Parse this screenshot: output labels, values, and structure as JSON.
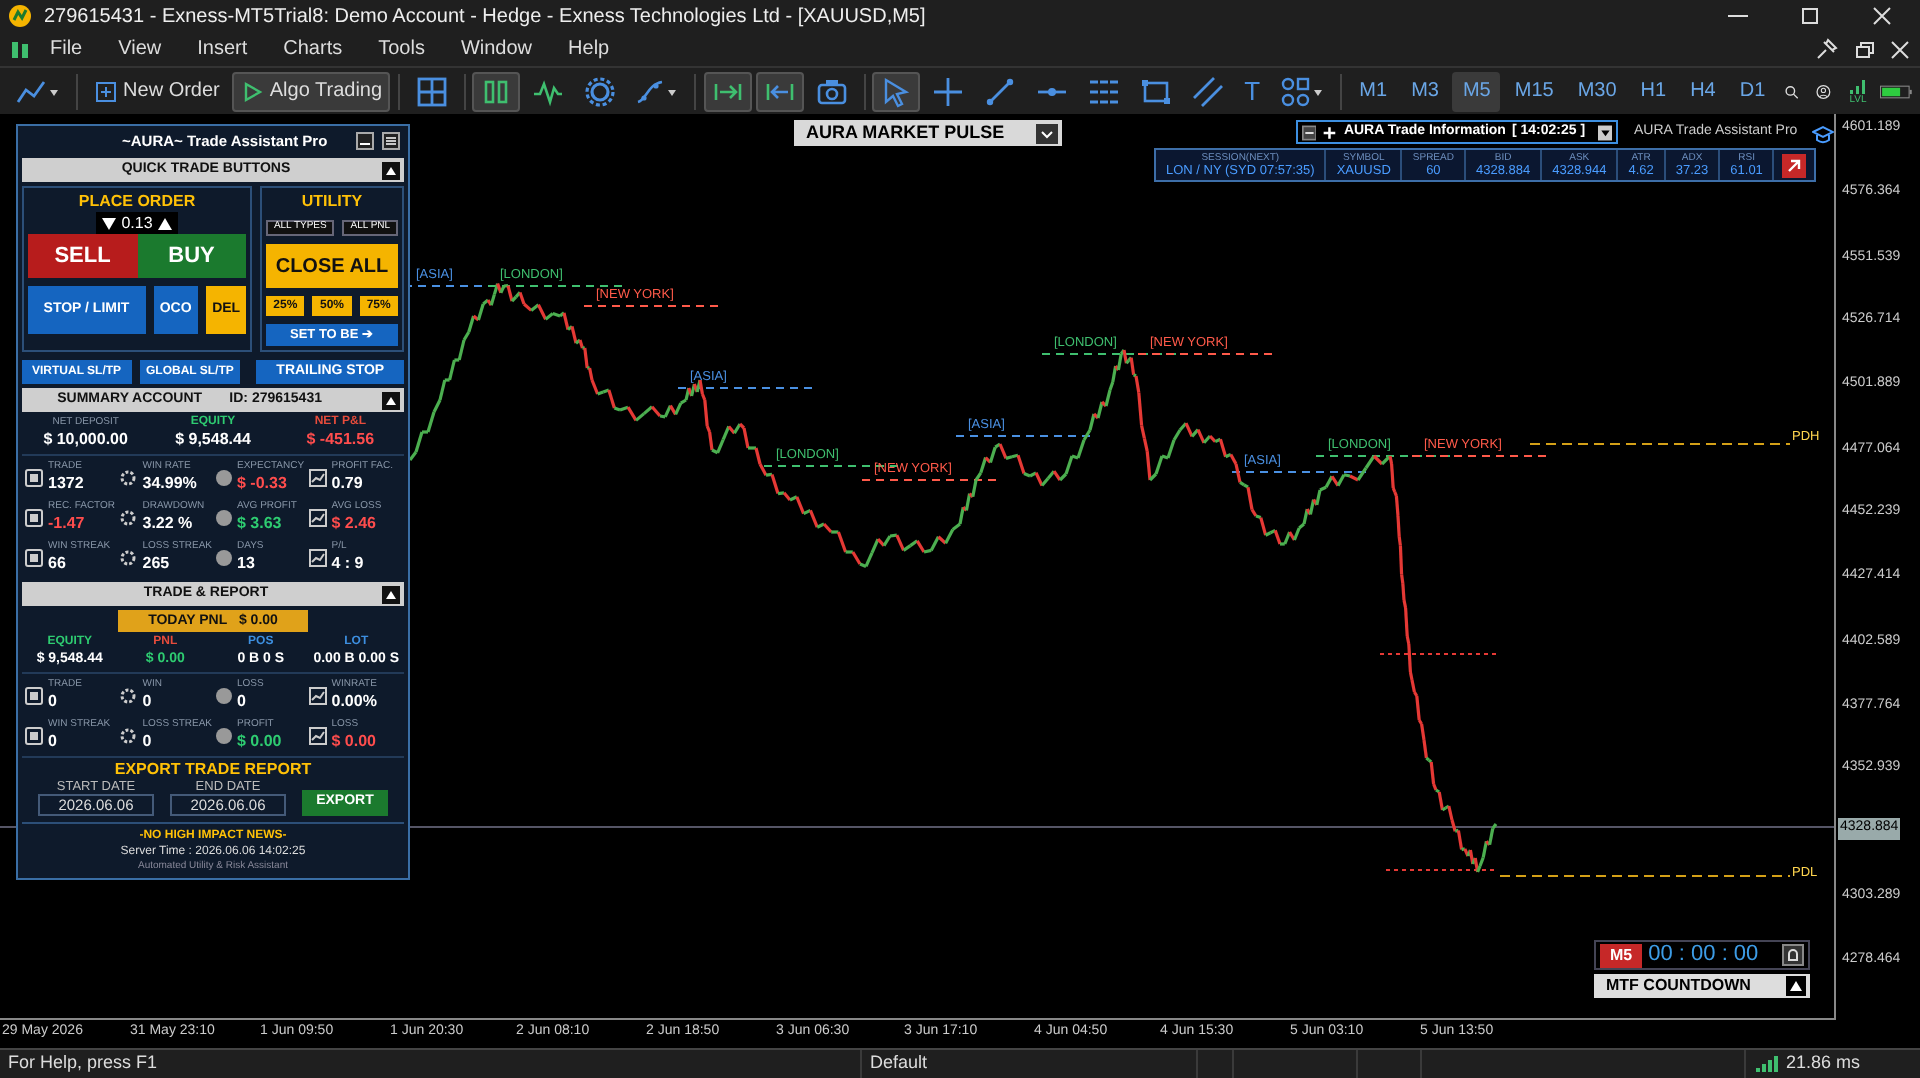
{
  "window": {
    "title": "279615431 - Exness-MT5Trial8: Demo Account - Hedge - Exness Technologies Ltd - [XAUUSD,M5]"
  },
  "menu": [
    "File",
    "View",
    "Insert",
    "Charts",
    "Tools",
    "Window",
    "Help"
  ],
  "toolbar": {
    "items": [
      {
        "kind": "chart-menu",
        "selected": false
      },
      {
        "kind": "new-order",
        "label": "New Order",
        "selected": false
      },
      {
        "kind": "algo-trading",
        "label": "Algo Trading",
        "selected": true
      },
      {
        "kind": "grid",
        "selected": false
      },
      {
        "kind": "candles",
        "selected": true
      },
      {
        "kind": "wave",
        "selected": false
      },
      {
        "kind": "gear",
        "selected": false
      },
      {
        "kind": "indicators",
        "selected": false
      },
      {
        "kind": "scroll",
        "selected": true
      },
      {
        "kind": "autoscroll",
        "selected": true
      },
      {
        "kind": "camera",
        "selected": false
      },
      {
        "kind": "cursor",
        "selected": true
      },
      {
        "kind": "crosshair",
        "selected": false
      },
      {
        "kind": "trendline",
        "selected": false
      },
      {
        "kind": "hline",
        "selected": false
      },
      {
        "kind": "channel",
        "selected": false
      },
      {
        "kind": "rectangle",
        "selected": false
      },
      {
        "kind": "fibo",
        "selected": false
      },
      {
        "kind": "text-tool",
        "label": "T",
        "selected": false
      },
      {
        "kind": "shapes",
        "selected": false
      }
    ],
    "timeframes": [
      {
        "label": "M1",
        "selected": false
      },
      {
        "label": "M3",
        "selected": false
      },
      {
        "label": "M5",
        "selected": true
      },
      {
        "label": "M15",
        "selected": false
      },
      {
        "label": "M30",
        "selected": false
      },
      {
        "label": "H1",
        "selected": false
      },
      {
        "label": "H4",
        "selected": false
      },
      {
        "label": "D1",
        "selected": false
      }
    ],
    "signal_label": "LVL"
  },
  "chart": {
    "market_pulse": "AURA MARKET PULSE",
    "trade_info": {
      "title": "AURA Trade Information",
      "time": "[ 14:02:25 ]",
      "columns": [
        {
          "header": "SESSION(NEXT)",
          "value": "LON / NY (SYD 07:57:35)"
        },
        {
          "header": "SYMBOL",
          "value": "XAUUSD"
        },
        {
          "header": "SPREAD",
          "value": "60"
        },
        {
          "header": "BID",
          "value": "4328.884"
        },
        {
          "header": "ASK",
          "value": "4328.944"
        },
        {
          "header": "ATR",
          "value": "4.62"
        },
        {
          "header": "ADX",
          "value": "37.23"
        },
        {
          "header": "RSI",
          "value": "61.01"
        }
      ]
    },
    "brand": "AURA Trade Assistant Pro",
    "session_labels": [
      {
        "text": "[ASIA]",
        "color": "#4a90e2"
      },
      {
        "text": "[LONDON]",
        "color": "#3fbf6f"
      },
      {
        "text": "[NEW YORK]",
        "color": "#ff5a4a"
      },
      {
        "text": "[ASIA]",
        "color": "#4a90e2"
      },
      {
        "text": "[LONDON]",
        "color": "#3fbf6f"
      },
      {
        "text": "[NEW YORK]",
        "color": "#ff5a4a"
      },
      {
        "text": "[ASIA]",
        "color": "#4a90e2"
      },
      {
        "text": "[LONDON]",
        "color": "#3fbf6f"
      },
      {
        "text": "[NEW YORK]",
        "color": "#ff5a4a"
      },
      {
        "text": "[ASIA]",
        "color": "#4a90e2"
      },
      {
        "text": "[LONDON]",
        "color": "#3fbf6f"
      },
      {
        "text": "[NEW YORK]",
        "color": "#ff5a4a"
      }
    ],
    "level_labels": [
      "PDH",
      "PDL"
    ],
    "price_axis": [
      "4601.189",
      "4576.364",
      "4551.539",
      "4526.714",
      "4501.889",
      "4477.064",
      "4452.239",
      "4427.414",
      "4402.589",
      "4377.764",
      "4352.939",
      "4303.289",
      "4278.464"
    ],
    "current_price": "4328.884",
    "time_axis": [
      "29 May 2026",
      "31 May 23:10",
      "1 Jun 09:50",
      "1 Jun 20:30",
      "2 Jun 08:10",
      "2 Jun 18:50",
      "3 Jun 06:30",
      "3 Jun 17:10",
      "4 Jun 04:50",
      "4 Jun 15:30",
      "5 Jun 03:10",
      "5 Jun 13:50"
    ],
    "countdown": {
      "timeframe": "M5",
      "time": "00 : 00 : 00",
      "title": "MTF COUNTDOWN"
    }
  },
  "panel": {
    "title": "~AURA~ Trade Assistant Pro",
    "quick_trade": {
      "title": "QUICK TRADE BUTTONS",
      "place_order": {
        "title": "PLACE ORDER",
        "sell": "SELL",
        "buy": "BUY",
        "lot": "0.13",
        "buttons": [
          {
            "label": "STOP / LIMIT",
            "kind": "blue"
          },
          {
            "label": "OCO",
            "kind": "blue"
          },
          {
            "label": "DEL",
            "kind": "yellow"
          }
        ]
      },
      "utility": {
        "title": "UTILITY",
        "filters": [
          "ALL TYPES",
          "ALL PNL"
        ],
        "close_all": "CLOSE ALL",
        "partials": [
          "25%",
          "50%",
          "75%"
        ],
        "breakeven": "SET TO BE ➔"
      },
      "bottom_buttons": [
        "VIRTUAL SL/TP",
        "GLOBAL SL/TP",
        "TRAILING STOP"
      ]
    },
    "summary": {
      "title": "SUMMARY ACCOUNT",
      "id": "ID: 279615431",
      "totals": [
        {
          "label": {
            "text": "NET DEPOSIT"
          },
          "value": {
            "text": "$ 10,000.00"
          }
        },
        {
          "label": {
            "text": "EQUITY",
            "color": "#2ecc71"
          },
          "value": {
            "text": "$ 9,548.44"
          }
        },
        {
          "label": {
            "text": "NET P&L",
            "color": "#e74c3c"
          },
          "value": {
            "text": "$ -451.56",
            "color": "#ff4d4d"
          }
        }
      ],
      "stats": [
        {
          "label": "TRADE",
          "value": "1372"
        },
        {
          "label": "WIN RATE",
          "value": "34.99%"
        },
        {
          "label": "EXPECTANCY",
          "value": "$ -0.33",
          "color": "#ff4d4d"
        },
        {
          "label": "PROFIT FAC.",
          "value": "0.79"
        },
        {
          "label": "REC. FACTOR",
          "value": "-1.47",
          "color": "#ff4d4d"
        },
        {
          "label": "DRAWDOWN",
          "value": "3.22 %"
        },
        {
          "label": "AVG PROFIT",
          "value": "$ 3.63",
          "color": "#2ecc71"
        },
        {
          "label": "AVG LOSS",
          "value": "$ 2.46",
          "color": "#ff4d4d"
        },
        {
          "label": "WIN STREAK",
          "value": "66"
        },
        {
          "label": "LOSS STREAK",
          "value": "265"
        },
        {
          "label": "DAYS",
          "value": "13"
        },
        {
          "label": "P/L",
          "value": "4 : 9"
        }
      ]
    },
    "trade_report": {
      "title": "TRADE & REPORT",
      "today": {
        "label": "TODAY PNL",
        "value": "$ 0.00"
      },
      "totals": [
        {
          "label": {
            "text": "EQUITY",
            "color": "#2ecc71"
          },
          "value": {
            "text": "$ 9,548.44"
          }
        },
        {
          "label": {
            "text": "PNL",
            "color": "#e74c3c"
          },
          "value": {
            "text": "$ 0.00",
            "color": "#2ecc71"
          }
        },
        {
          "label": {
            "text": "POS",
            "color": "#3d8fe0"
          },
          "value": {
            "text": "0 B 0 S"
          }
        },
        {
          "label": {
            "text": "LOT",
            "color": "#3d8fe0"
          },
          "value": {
            "text": "0.00 B 0.00 S"
          }
        }
      ],
      "stats": [
        {
          "label": "TRADE",
          "value": "0"
        },
        {
          "label": "WIN",
          "value": "0"
        },
        {
          "label": "LOSS",
          "value": "0"
        },
        {
          "label": "WINRATE",
          "value": "0.00%"
        },
        {
          "label": "WIN STREAK",
          "value": "0"
        },
        {
          "label": "LOSS STREAK",
          "value": "0"
        },
        {
          "label": "PROFIT",
          "value": "$ 0.00",
          "color": "#2ecc71"
        },
        {
          "label": "LOSS",
          "value": "$ 0.00",
          "color": "#ff4d4d"
        }
      ],
      "export": {
        "title": "EXPORT TRADE REPORT",
        "start_label": "START DATE",
        "start": "2026.06.06",
        "end_label": "END DATE",
        "end": "2026.06.06",
        "button": "EXPORT"
      }
    },
    "news": {
      "headline": "-NO HIGH IMPACT NEWS-",
      "server_time": "Server Time : 2026.06.06 14:02:25",
      "tagline": "Automated Utility & Risk Assistant"
    }
  },
  "status_bar": {
    "help": "For Help, press F1",
    "profile": "Default",
    "ping": "21.86 ms"
  }
}
